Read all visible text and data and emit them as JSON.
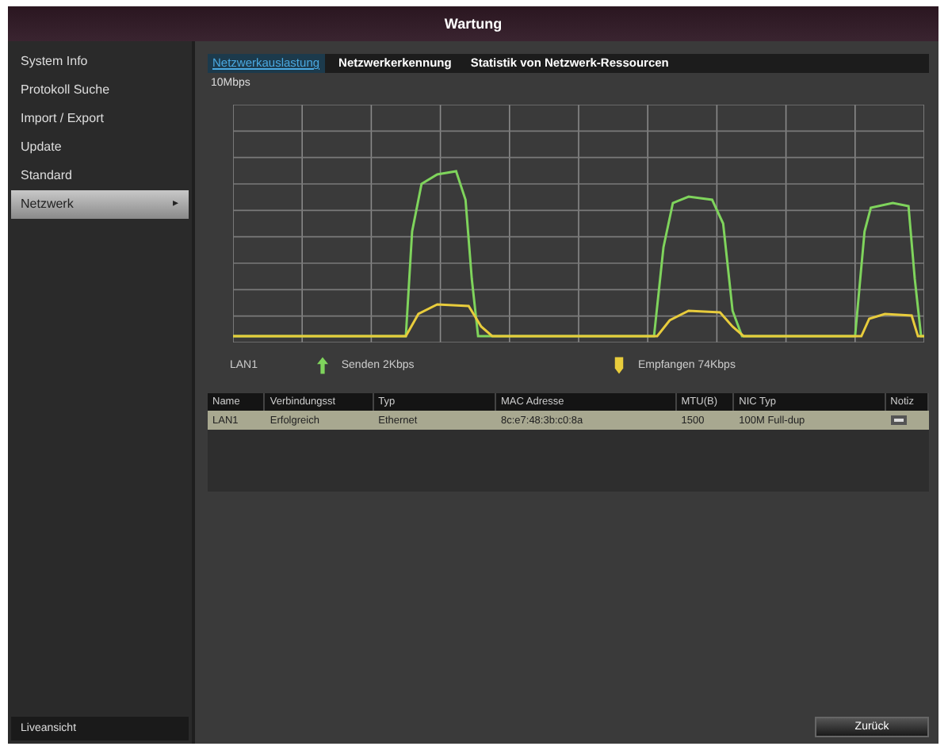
{
  "window": {
    "title": "Wartung"
  },
  "sidebar": {
    "items": [
      {
        "label": "System Info",
        "selected": false
      },
      {
        "label": "Protokoll Suche",
        "selected": false
      },
      {
        "label": "Import / Export",
        "selected": false
      },
      {
        "label": "Update",
        "selected": false
      },
      {
        "label": "Standard",
        "selected": false
      },
      {
        "label": "Netzwerk",
        "selected": true,
        "arrow": "▸"
      }
    ],
    "footer": "Liveansicht"
  },
  "tabs": [
    {
      "label": "Netzwerkauslastung",
      "selected": true
    },
    {
      "label": "Netzwerkerkennung",
      "selected": false
    },
    {
      "label": "Statistik von Netzwerk-Ressourcen",
      "selected": false
    }
  ],
  "graph": {
    "scale": "10Mbps",
    "legend_name": "LAN1",
    "legend": [
      {
        "label": "Senden 2Kbps",
        "color": "#7fd45c",
        "kind": "arrow"
      },
      {
        "label": "Empfangen 74Kbps",
        "color": "#e8cc3c",
        "kind": "marker"
      }
    ]
  },
  "table": {
    "columns": [
      "Name",
      "Verbindungsst",
      "Typ",
      "MAC Adresse",
      "MTU(B)",
      "NIC Typ",
      "Notiz"
    ],
    "rows": [
      {
        "cells": [
          "LAN1",
          "Erfolgreich",
          "Ethernet",
          "8c:e7:48:3b:c0:8a",
          "1500",
          "100M Full-dup"
        ],
        "selected": true
      }
    ]
  },
  "buttons": [
    "Zurück"
  ]
}
